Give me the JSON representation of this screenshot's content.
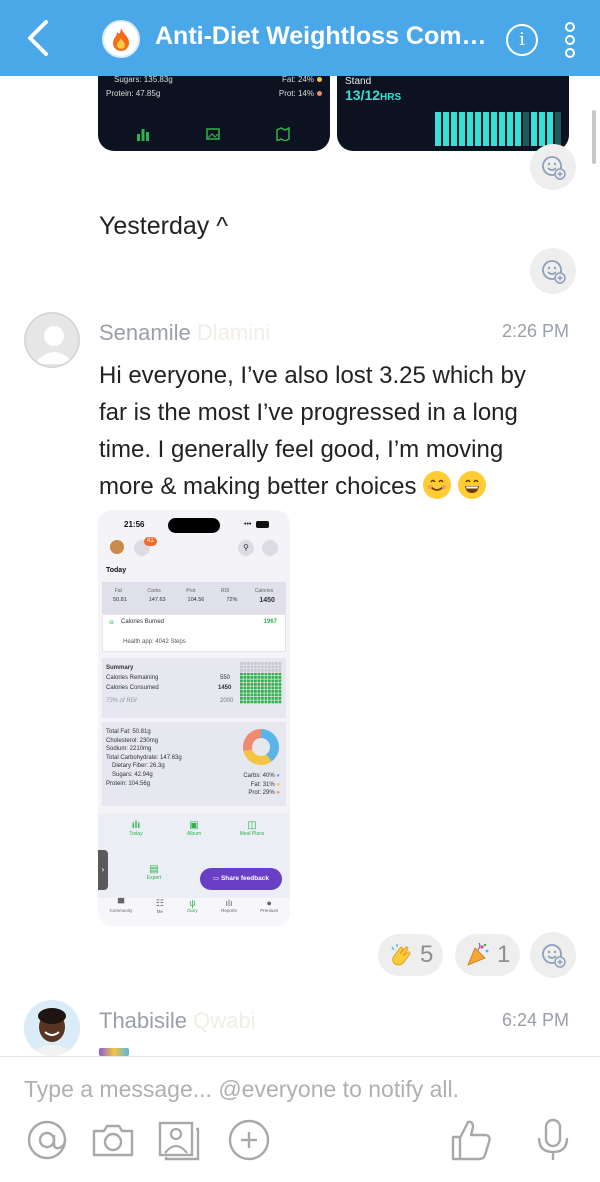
{
  "header": {
    "title": "Anti-Diet Weightloss Comm...",
    "info_label": "i"
  },
  "cards": {
    "sugars": "Sugars: 135.83g",
    "protein": "Protein: 47.85g",
    "fat": "Fat: 24%",
    "prot": "Prot: 14%",
    "stand_label": "Stand",
    "stand_value": "13/12",
    "stand_unit": "HRS"
  },
  "chat": {
    "day_label": "Yesterday ^",
    "messages": [
      {
        "sender_first": "Senamile",
        "sender_last": "Dlamini",
        "time": "2:26 PM",
        "text": "Hi everyone, I’ve also lost 3.25 which by far is the most I’ve progressed in a long time. I generally feel good, I’m moving more & making better choices"
      },
      {
        "sender_first": "Thabisile",
        "sender_last": "Qwabi",
        "time": "6:24 PM"
      }
    ],
    "reactions": [
      {
        "icon": "clap-emoji",
        "count": "5"
      },
      {
        "icon": "party-popper-emoji",
        "count": "1"
      }
    ]
  },
  "screenshot": {
    "time": "21:56",
    "badge": "41",
    "today": "Today",
    "macro_headers": [
      "Fat",
      "Carbs",
      "Prot",
      "RDI",
      "Calories"
    ],
    "macro_values": [
      "50.81",
      "147.63",
      "104.56",
      "72%",
      "1450"
    ],
    "calories_burned_label": "Calories Burned",
    "calories_burned_value": "1967",
    "health_app": "Health app: 4042 Steps",
    "summary_title": "Summary",
    "summary_rows": [
      {
        "label": "Calories Remaining",
        "value": "550"
      },
      {
        "label": "Calories Consumed",
        "value": "1450"
      },
      {
        "label": "73% of RDI",
        "value": "2000"
      }
    ],
    "nutrients": [
      "Total Fat: 50.81g",
      "Cholesterol: 230mg",
      "Sodium: 2210mg",
      "Total Carbohydrate: 147.63g",
      "Dietary Fiber: 26.3g",
      "Sugars: 42.94g",
      "Protein: 104.56g"
    ],
    "legend": [
      "Carbs: 40%",
      "Fat: 31%",
      "Prot: 29%"
    ],
    "nav_top": [
      "Today",
      "Album",
      "Meal Plans"
    ],
    "expert": "Expert",
    "feedback_button": "Share feedback",
    "nav_bottom": [
      "Community",
      "Me",
      "Diary",
      "Reports",
      "Premium"
    ],
    "pie": [
      40,
      31,
      29
    ],
    "colors": {
      "carbs": "#5ab4e6",
      "fat": "#f4c542",
      "prot": "#f08a6e",
      "accent": "#2fb34a",
      "feedback": "#6a3fc8"
    }
  },
  "composer": {
    "placeholder": "Type a message... @everyone to notify all."
  },
  "colors": {
    "header": "#4aa8e8",
    "stand": "#35e0d5"
  }
}
